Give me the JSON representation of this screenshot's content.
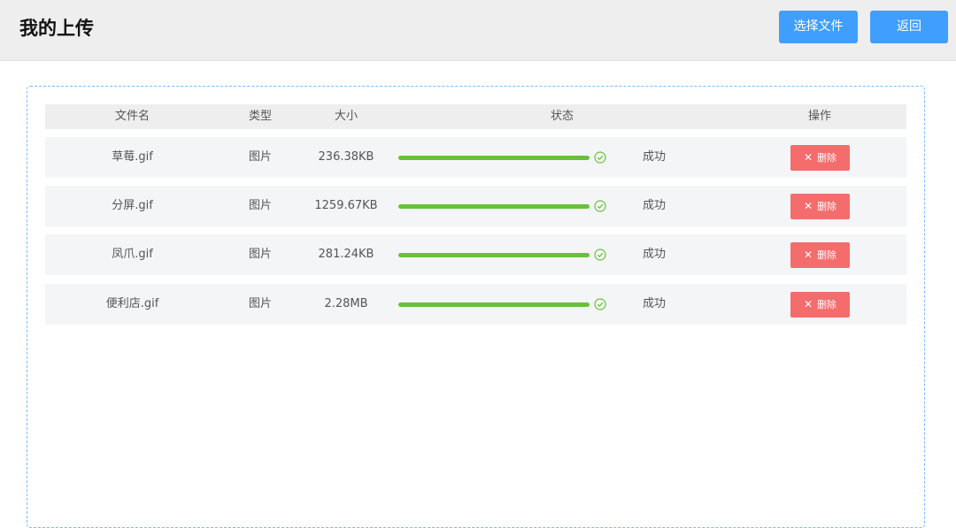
{
  "header": {
    "title": "我的上传",
    "select_label": "选择文件",
    "back_label": "返回"
  },
  "table": {
    "columns": {
      "name": "文件名",
      "type": "类型",
      "size": "大小",
      "status": "状态",
      "op": "操作"
    },
    "rows": [
      {
        "name": "草莓.gif",
        "type": "图片",
        "size": "236.38KB",
        "progress": 100,
        "status": "成功",
        "delete_label": "删除"
      },
      {
        "name": "分屏.gif",
        "type": "图片",
        "size": "1259.67KB",
        "progress": 100,
        "status": "成功",
        "delete_label": "删除"
      },
      {
        "name": "凤爪.gif",
        "type": "图片",
        "size": "281.24KB",
        "progress": 100,
        "status": "成功",
        "delete_label": "删除"
      },
      {
        "name": "便利店.gif",
        "type": "图片",
        "size": "2.28MB",
        "progress": 100,
        "status": "成功",
        "delete_label": "删除"
      }
    ]
  },
  "icons": {
    "status": "check-circle-icon",
    "delete": "close-icon"
  },
  "colors": {
    "primary": "#409eff",
    "success": "#67c23a",
    "danger": "#f56c6c"
  }
}
